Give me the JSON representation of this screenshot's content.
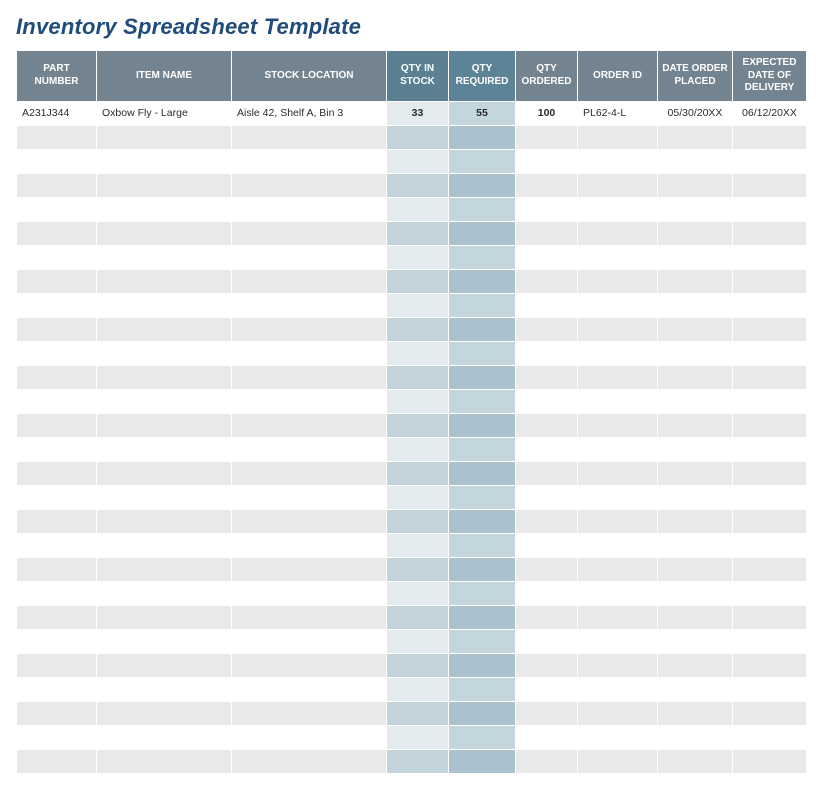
{
  "title": "Inventory Spreadsheet Template",
  "columns": [
    {
      "key": "part_number",
      "label": "PART NUMBER"
    },
    {
      "key": "item_name",
      "label": "ITEM NAME"
    },
    {
      "key": "stock_location",
      "label": "STOCK LOCATION"
    },
    {
      "key": "qty_in_stock",
      "label": "QTY IN STOCK"
    },
    {
      "key": "qty_required",
      "label": "QTY REQUIRED"
    },
    {
      "key": "qty_ordered",
      "label": "QTY ORDERED"
    },
    {
      "key": "order_id",
      "label": "ORDER ID"
    },
    {
      "key": "date_order_placed",
      "label": "DATE ORDER PLACED"
    },
    {
      "key": "expected_date_of_delivery",
      "label": "EXPECTED DATE OF DELIVERY"
    }
  ],
  "rows": [
    {
      "part_number": "A231J344",
      "item_name": "Oxbow Fly - Large",
      "stock_location": "Aisle 42, Shelf A, Bin 3",
      "qty_in_stock": "33",
      "qty_required": "55",
      "qty_ordered": "100",
      "order_id": "PL62-4-L",
      "date_order_placed": "05/30/20XX",
      "expected_date_of_delivery": "06/12/20XX"
    }
  ],
  "empty_rows": 27
}
